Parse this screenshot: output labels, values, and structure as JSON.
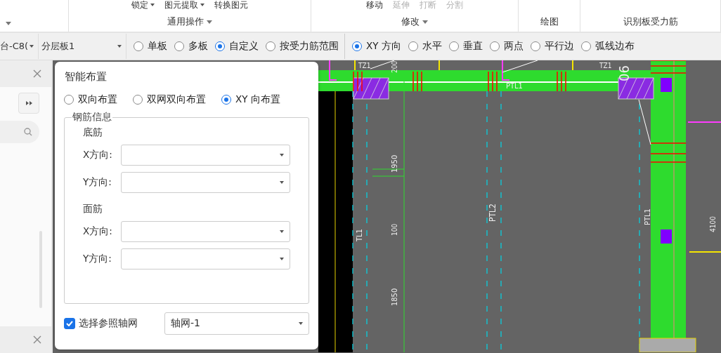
{
  "ribbon": {
    "groups": [
      {
        "label": "通用操作",
        "menu": true,
        "items": [
          {
            "label": "锁定",
            "disabled": false,
            "menu": true
          },
          {
            "label": "图元提取",
            "disabled": false,
            "menu": true
          },
          {
            "label": "转换图元",
            "disabled": false,
            "menu": false
          }
        ]
      },
      {
        "label": "修改",
        "menu": true,
        "items": [
          {
            "label": "移动",
            "disabled": false,
            "menu": false
          },
          {
            "label": "延伸",
            "disabled": true,
            "menu": false
          },
          {
            "label": "打断",
            "disabled": true,
            "menu": false
          },
          {
            "label": "分割",
            "disabled": true,
            "menu": false
          }
        ]
      },
      {
        "label": "绘图",
        "menu": false
      },
      {
        "label": "识别板受力筋",
        "menu": false
      }
    ]
  },
  "toolbar": {
    "dropdowns": [
      {
        "value": "台-C8("
      },
      {
        "value": "分层板1"
      }
    ],
    "radio_groups": [
      [
        {
          "label": "单板",
          "selected": false
        },
        {
          "label": "多板",
          "selected": false
        },
        {
          "label": "自定义",
          "selected": true
        },
        {
          "label": "按受力筋范围",
          "selected": false
        }
      ],
      [
        {
          "label": "XY 方向",
          "selected": true
        },
        {
          "label": "水平",
          "selected": false
        },
        {
          "label": "垂直",
          "selected": false
        },
        {
          "label": "两点",
          "selected": false
        },
        {
          "label": "平行边",
          "selected": false
        },
        {
          "label": "弧线边布",
          "selected": false
        }
      ]
    ]
  },
  "dialog": {
    "title": "智能布置",
    "modes": [
      {
        "label": "双向布置",
        "selected": false
      },
      {
        "label": "双网双向布置",
        "selected": false
      },
      {
        "label": "XY 向布置",
        "selected": true
      }
    ],
    "group_title": "钢筋信息",
    "sections": [
      {
        "title": "底筋",
        "fields": [
          {
            "label": "X方向:"
          },
          {
            "label": "Y方向:"
          }
        ]
      },
      {
        "title": "面筋",
        "fields": [
          {
            "label": "X方向:"
          },
          {
            "label": "Y方向:"
          }
        ]
      }
    ],
    "axis_grid": {
      "label": "选择参照轴网",
      "checked": true,
      "value": "轴网-1"
    }
  },
  "drawing": {
    "labels": [
      "TZ1",
      "200",
      "PTL1",
      "TZ1",
      "06",
      "1950",
      "TL1",
      "100",
      "PTL2",
      "PTL1",
      "4100",
      "1850"
    ]
  }
}
